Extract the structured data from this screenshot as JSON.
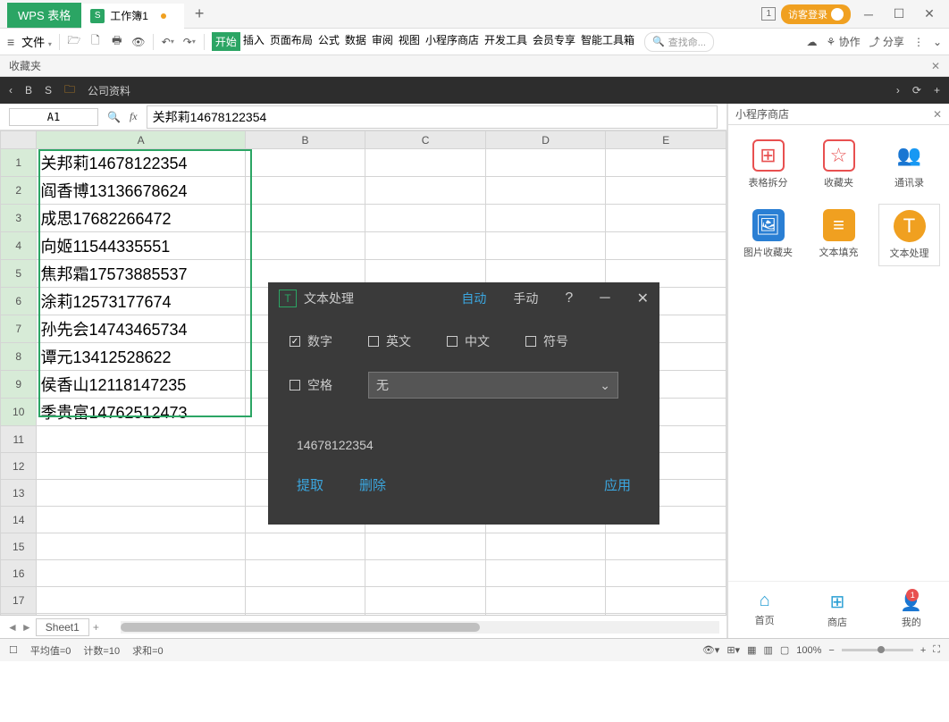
{
  "titlebar": {
    "app": "WPS 表格",
    "tab": "工作簿1",
    "pages": "1",
    "login": "访客登录"
  },
  "toolbar": {
    "file": "文件",
    "ribbon": [
      "开始",
      "插入",
      "页面布局",
      "公式",
      "数据",
      "审阅",
      "视图",
      "小程序商店",
      "开发工具",
      "会员专享",
      "智能工具箱"
    ],
    "search_placeholder": "查找命...",
    "collab": "协作",
    "share": "分享"
  },
  "favorites_label": "收藏夹",
  "nav": {
    "b": "B",
    "s": "S",
    "folder": "公司资料"
  },
  "cell_ref": "A1",
  "formula_value": "关邦莉14678122354",
  "columns": [
    "A",
    "B",
    "C",
    "D",
    "E"
  ],
  "rows": [
    "关邦莉14678122354",
    "阎香博13136678624",
    "成思17682266472",
    "向姬11544335551",
    "焦邦霜17573885537",
    "涂莉12573177674",
    "孙先会14743465734",
    "谭元13412528622",
    "侯香山12118147235",
    "季贵富14762512473"
  ],
  "side": {
    "title": "小程序商店",
    "tiles": [
      "表格拆分",
      "收藏夹",
      "通讯录",
      "图片收藏夹",
      "文本填充",
      "文本处理"
    ],
    "bottom": [
      "首页",
      "商店",
      "我的"
    ],
    "badge": "1"
  },
  "sheet_tab": "Sheet1",
  "status": {
    "avg": "平均值=0",
    "count": "计数=10",
    "sum": "求和=0",
    "zoom": "100%"
  },
  "popup": {
    "title": "文本处理",
    "tab_auto": "自动",
    "tab_manual": "手动",
    "chk_num": "数字",
    "chk_eng": "英文",
    "chk_cn": "中文",
    "chk_sym": "符号",
    "chk_space": "空格",
    "select_val": "无",
    "preview": "14678122354",
    "act_extract": "提取",
    "act_delete": "删除",
    "act_apply": "应用"
  }
}
